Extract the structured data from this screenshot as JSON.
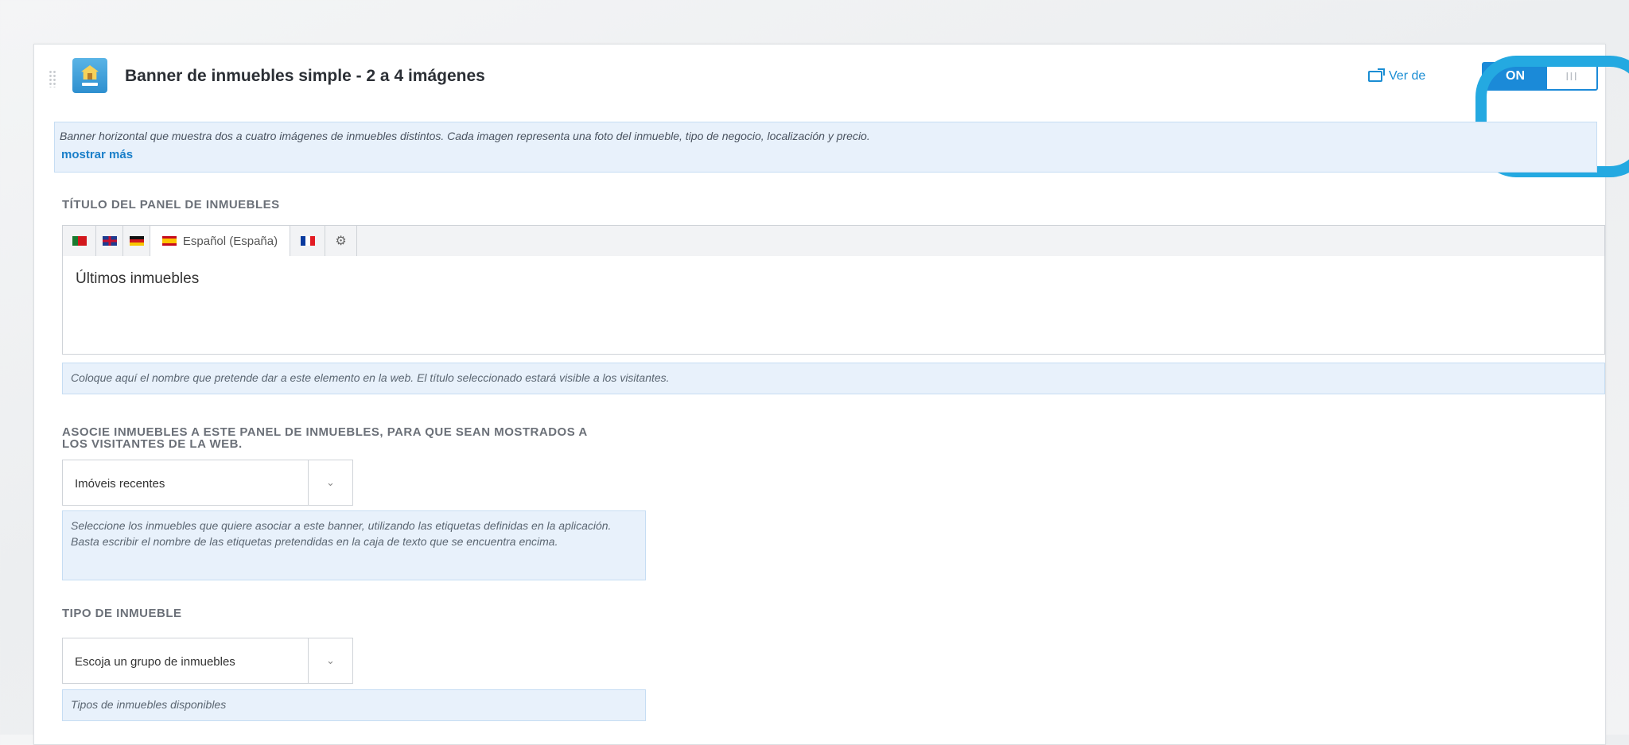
{
  "module": {
    "title": "Banner de inmuebles simple - 2 a 4 imágenes",
    "ver_link": "Ver de",
    "toggle_label": "ON",
    "toggle_handle": "III",
    "description": "Banner horizontal que muestra dos a cuatro imágenes de inmuebles distintos. Cada imagen representa una foto del inmueble, tipo de negocio, localización y precio.",
    "show_more": "mostrar más"
  },
  "title_section": {
    "label": "TÍTULO DEL PANEL DE INMUEBLES",
    "languages": [
      {
        "icon": "flag-pt-icon",
        "label": ""
      },
      {
        "icon": "flag-gb-icon",
        "label": ""
      },
      {
        "icon": "flag-de-icon",
        "label": ""
      },
      {
        "icon": "flag-es-icon",
        "label": "Español (España)"
      },
      {
        "icon": "flag-fr-icon",
        "label": ""
      },
      {
        "icon": "gear-icon",
        "label": ""
      }
    ],
    "value": "Últimos inmuebles",
    "help": "Coloque aquí el nombre que pretende dar a este elemento en la web. El título seleccionado estará visible a los visitantes."
  },
  "associate_section": {
    "label_line1": "ASOCIE INMUEBLES A ESTE PANEL DE INMUEBLES, PARA QUE SEAN MOSTRADOS A",
    "label_line2": "LOS VISITANTES DE LA WEB.",
    "select_value": "Imóveis recentes",
    "help": "Seleccione los inmuebles que quiere asociar a este banner, utilizando las etiquetas definidas en la aplicación. Basta escribir el nombre de las etiquetas pretendidas en la caja de texto que se encuentra encima."
  },
  "type_section": {
    "label": "TIPO DE INMUEBLE",
    "select_value": "Escoja un grupo de inmuebles",
    "help": "Tipos de inmuebles disponibles"
  },
  "colors": {
    "accent": "#1b8ad8",
    "highlight_ring": "#24a9e1",
    "info_bg": "#e8f1fb"
  }
}
